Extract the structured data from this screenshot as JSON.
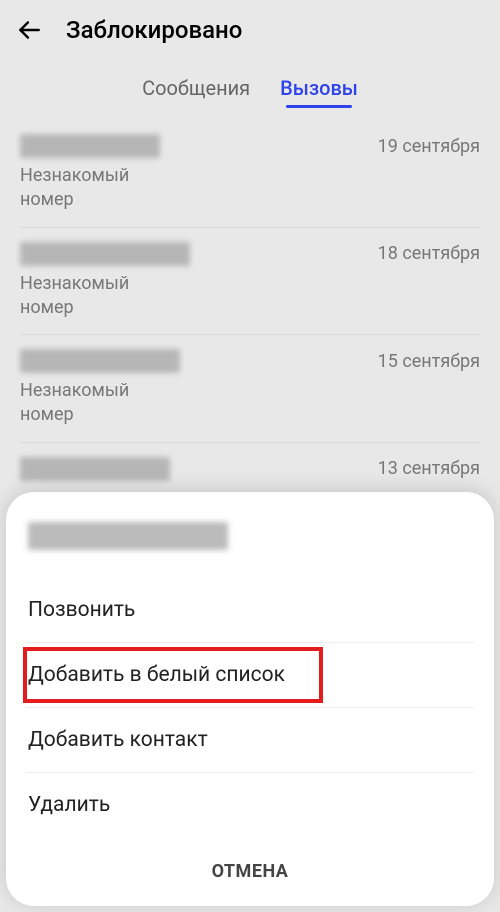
{
  "header": {
    "title": "Заблокировано"
  },
  "tabs": {
    "messages": "Сообщения",
    "calls": "Вызовы"
  },
  "list": {
    "items": [
      {
        "date": "19 сентября",
        "sub": "Незнакомый\nномер"
      },
      {
        "date": "18 сентября",
        "sub": "Незнакомый\nномер"
      },
      {
        "date": "15 сентября",
        "sub": "Незнакомый\nномер"
      },
      {
        "date": "13 сентября",
        "sub": ""
      }
    ]
  },
  "sheet": {
    "options": {
      "call": "Позвонить",
      "whitelist": "Добавить в белый список",
      "add_contact": "Добавить контакт",
      "delete": "Удалить"
    },
    "cancel": "ОТМЕНА"
  }
}
